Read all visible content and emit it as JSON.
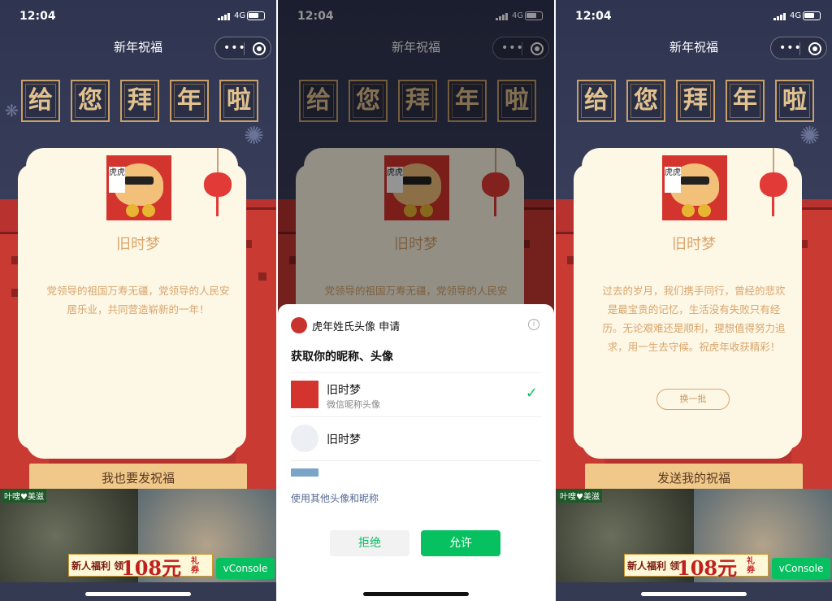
{
  "status": {
    "time": "12:04",
    "network": "4G"
  },
  "nav": {
    "title": "新年祝福",
    "more_icon": "more-dots-icon",
    "close_icon": "target-close-icon"
  },
  "banner": {
    "chars": [
      "给",
      "您",
      "拜",
      "年",
      "啦"
    ]
  },
  "card": {
    "nickname": "旧时梦",
    "blessing_1": "党领导的祖国万寿无疆，党领导的人民安居乐业，共同营造崭新的一年！",
    "blessing_3": "过去的岁月，我们携手同行，曾经的悲欢是最宝贵的记忆，生活没有失败只有经历。无论艰难还是顺利，理想值得努力追求，用一生去守候。祝虎年收获精彩！",
    "refresh_label": "换一批",
    "avatar_tag": "虎虎"
  },
  "buttons": {
    "send_too": "我也要发祝福",
    "send_mine": "发送我的祝福"
  },
  "ad": {
    "tag": "叶嗖♥美滋",
    "promo_a": "新人福利 领",
    "promo_b": "108元",
    "promo_c": "礼券"
  },
  "vconsole": "vConsole",
  "sheet": {
    "app_title": "虎年姓氏头像 申请",
    "ask": "获取你的昵称、头像",
    "options": [
      {
        "name": "旧时梦",
        "sub": "微信昵称头像",
        "selected": true
      },
      {
        "name": "旧时梦",
        "sub": "",
        "selected": false
      }
    ],
    "other": "使用其他头像和昵称",
    "deny": "拒绝",
    "allow": "允许"
  },
  "colors": {
    "accent_green": "#07c160",
    "gold": "#d9a56b",
    "red": "#b8322f"
  }
}
